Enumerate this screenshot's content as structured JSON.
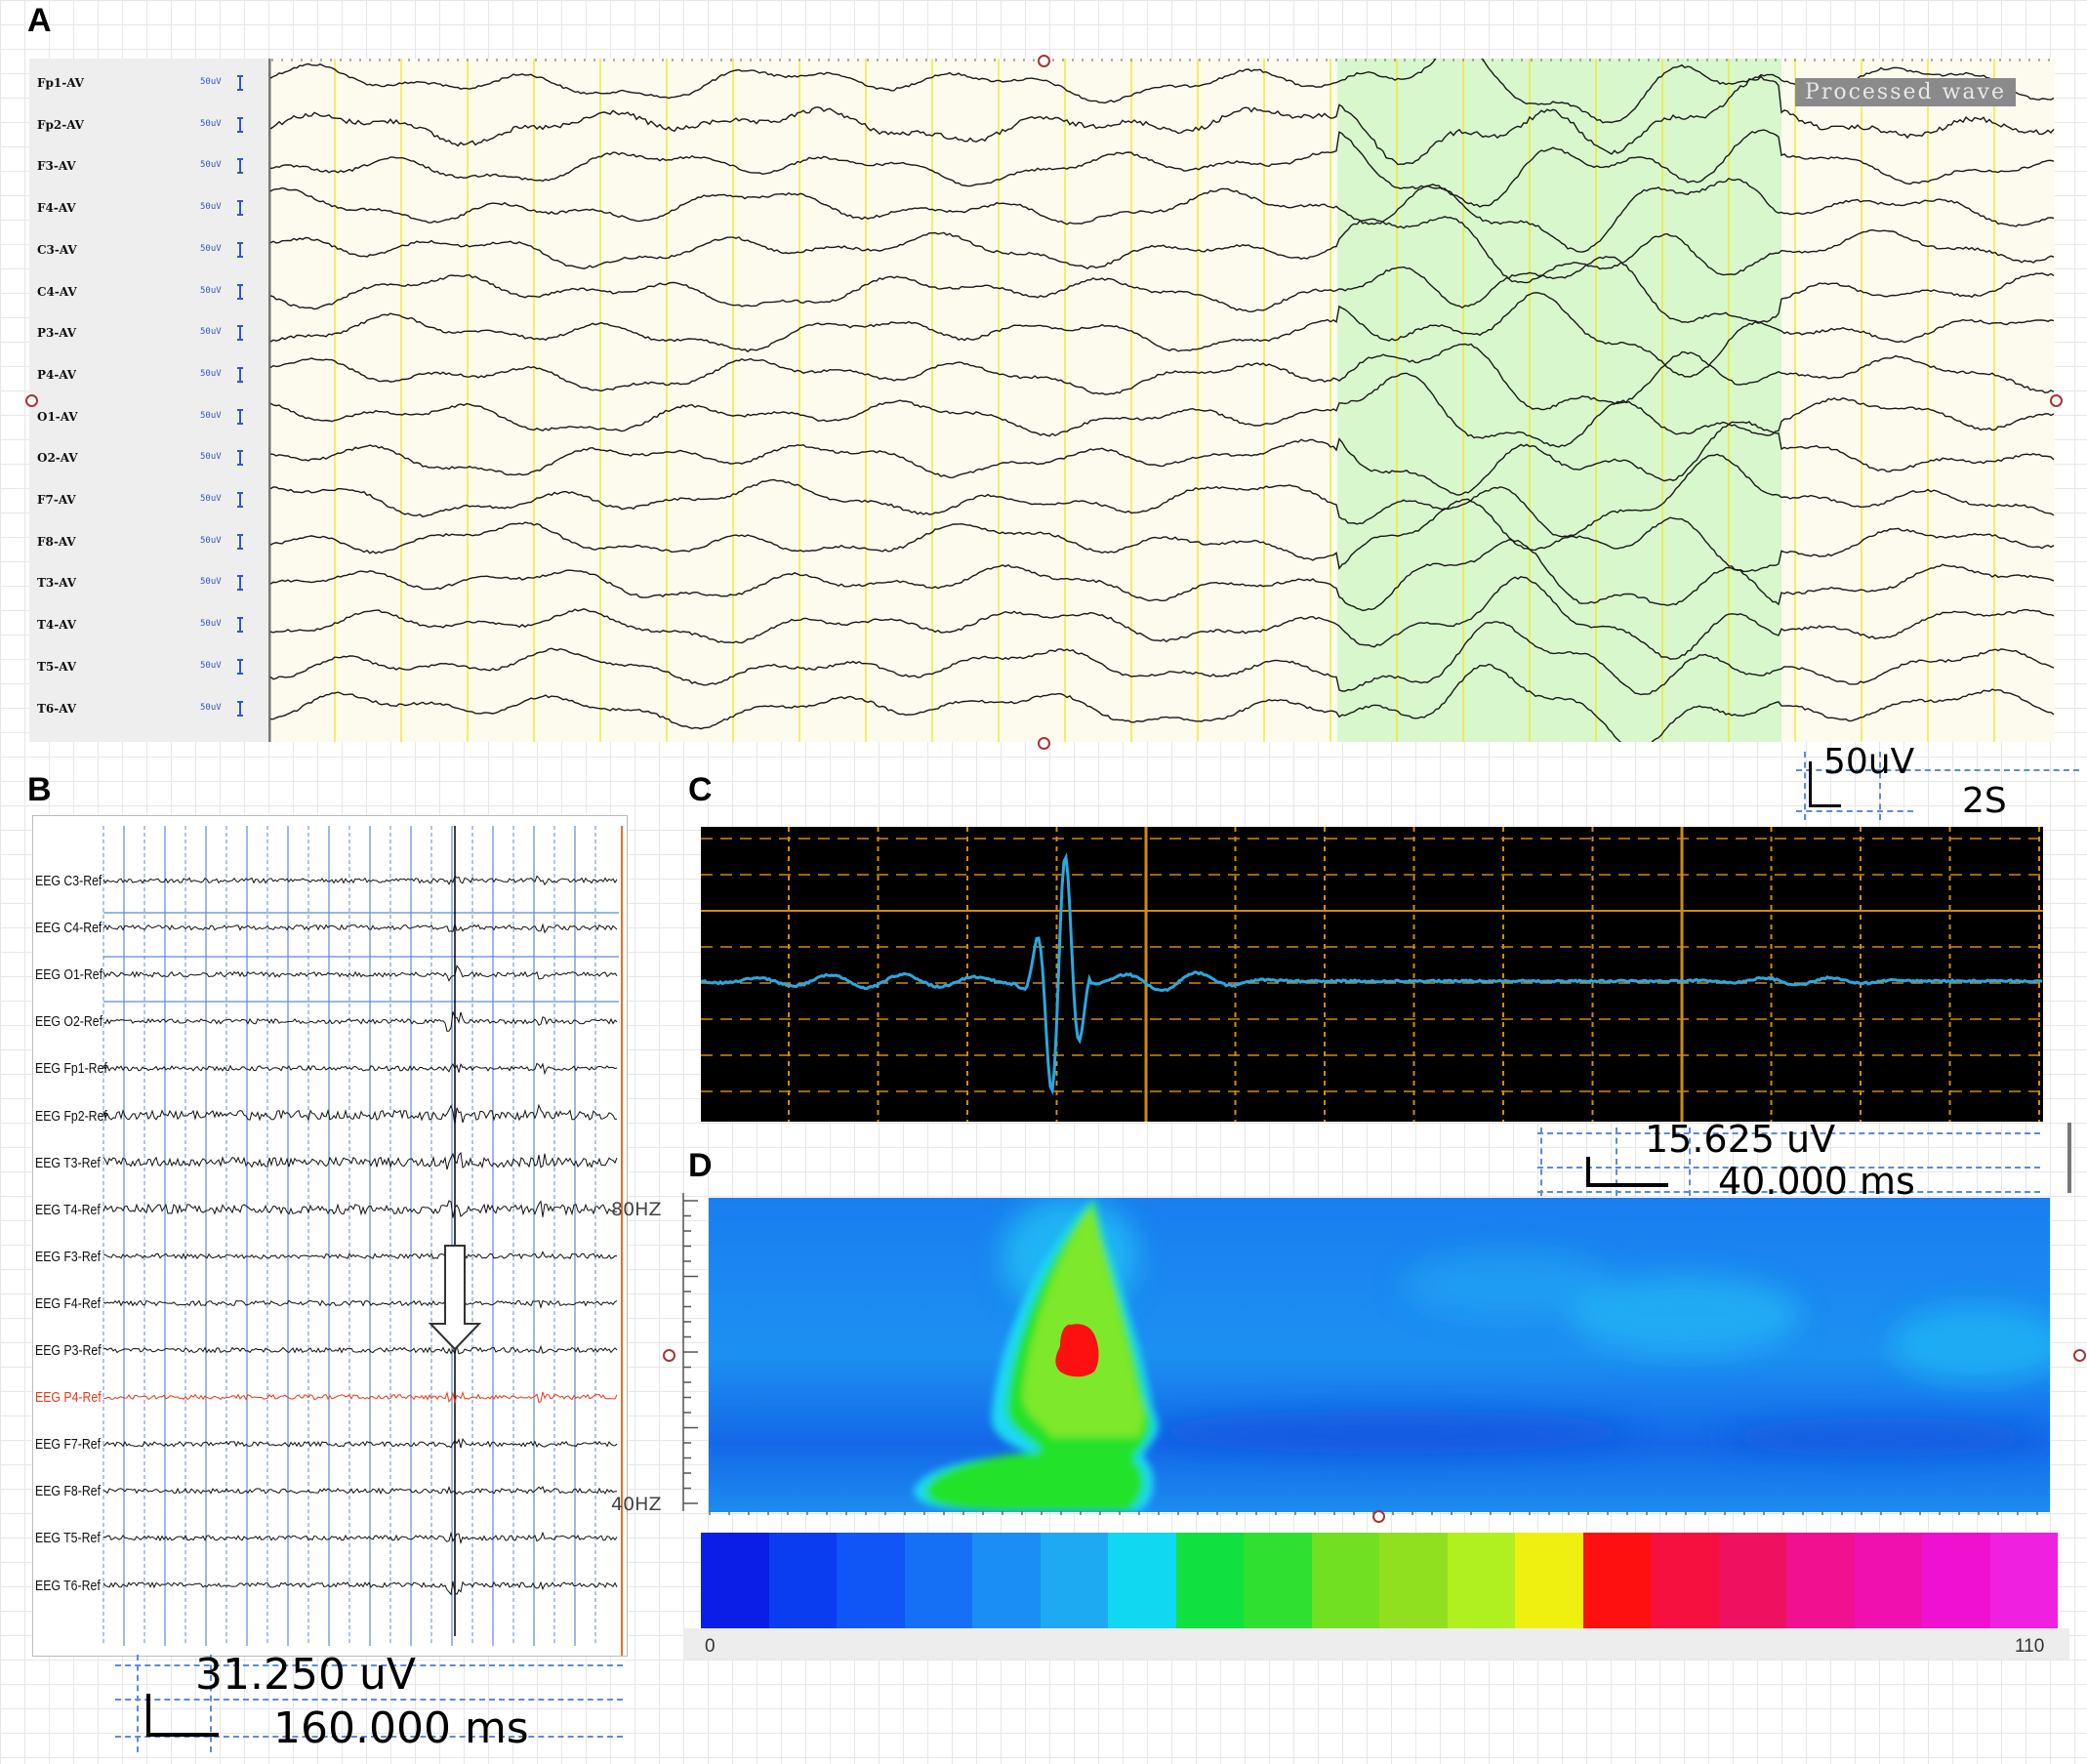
{
  "panels": {
    "a": {
      "letter": "A"
    },
    "b": {
      "letter": "B"
    },
    "c": {
      "letter": "C"
    },
    "d": {
      "letter": "D"
    }
  },
  "panel_a": {
    "channels": [
      "Fp1-AV",
      "Fp2-AV",
      "F3-AV",
      "F4-AV",
      "C3-AV",
      "C4-AV",
      "P3-AV",
      "P4-AV",
      "O1-AV",
      "O2-AV",
      "F7-AV",
      "F8-AV",
      "T3-AV",
      "T4-AV",
      "T5-AV",
      "T6-AV"
    ],
    "gain_label": "50uV",
    "badge": "Processed wave",
    "scale": {
      "amplitude": "50uV",
      "time": "2S"
    },
    "colors": {
      "background": "#fcfbee",
      "highlight": "#d8f7cc",
      "gridline": "#f0e830",
      "trace": "#1a1a1a"
    }
  },
  "panel_b": {
    "channels": [
      "EEG C3-Ref",
      "EEG C4-Ref",
      "EEG O1-Ref",
      "EEG O2-Ref",
      "EEG Fp1-Ref",
      "EEG Fp2-Ref",
      "EEG T3-Ref",
      "EEG T4-Ref",
      "EEG F3-Ref",
      "EEG F4-Ref",
      "EEG P3-Ref",
      "EEG P4-Ref",
      "EEG F7-Ref",
      "EEG F8-Ref",
      "EEG T5-Ref",
      "EEG T6-Ref"
    ],
    "highlighted_channel": "EEG P4-Ref",
    "highlight_color": "#e8391b",
    "scale": {
      "amplitude": "31.250 uV",
      "time": "160.000 ms"
    },
    "marker": "down-arrow-icon"
  },
  "panel_c": {
    "scale": {
      "amplitude": "15.625 uV",
      "time": "40.000 ms"
    },
    "colors": {
      "background": "#000000",
      "grid": "#d08a10",
      "trace": "#2aa8e0"
    }
  },
  "panel_d": {
    "freq_labels": {
      "top": "80HZ",
      "bottom": "40HZ"
    },
    "colorbar": {
      "min": "0",
      "max": "110",
      "colors": [
        "#0a1ee8",
        "#0a3cf0",
        "#1055f5",
        "#1570f5",
        "#1a8ef5",
        "#1eaaf2",
        "#10d8f0",
        "#10e040",
        "#30e030",
        "#70e020",
        "#90e020",
        "#b0f020",
        "#f0f010",
        "#ff1010",
        "#f51040",
        "#f01060",
        "#f01090",
        "#f010b0",
        "#f010d0",
        "#f020e0"
      ]
    }
  }
}
